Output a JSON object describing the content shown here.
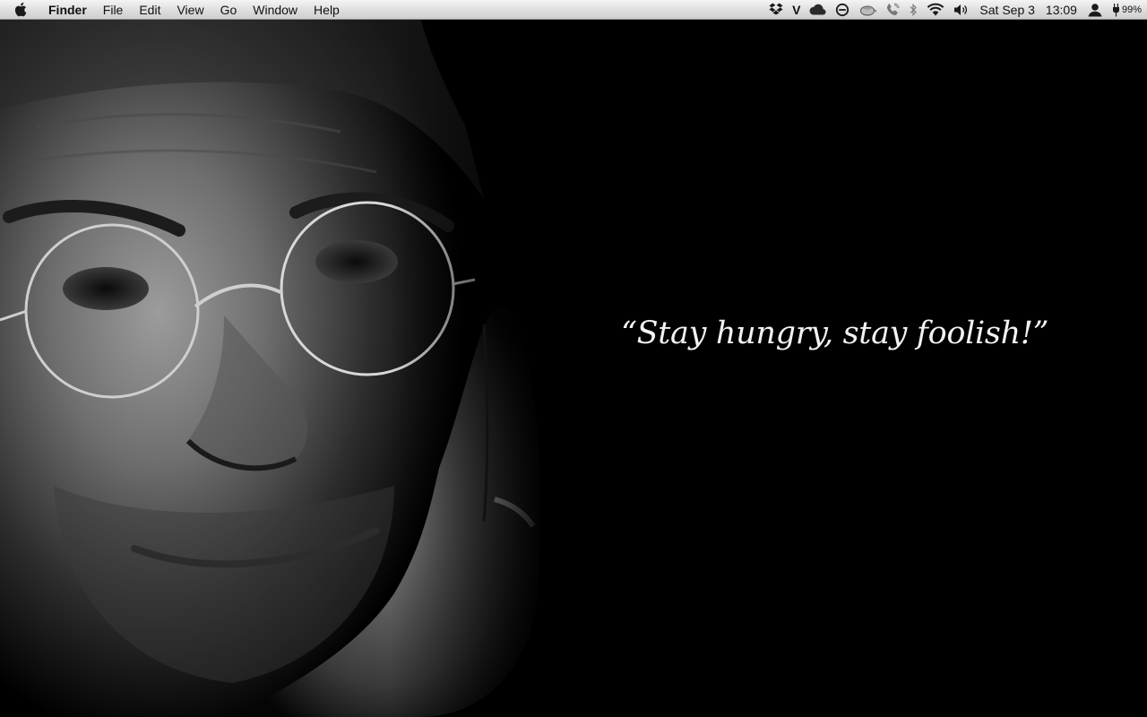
{
  "menubar": {
    "app_name": "Finder",
    "menus": [
      "File",
      "Edit",
      "View",
      "Go",
      "Window",
      "Help"
    ],
    "status_icons": [
      "dropbox-icon",
      "v-icon",
      "cloud-icon",
      "no-entry-icon",
      "teapot-icon",
      "phone-icon",
      "bluetooth-icon",
      "wifi-icon",
      "volume-icon"
    ],
    "v_label": "V",
    "date": "Sat Sep 3",
    "time": "13:09",
    "battery": "99%"
  },
  "wallpaper": {
    "quote": "“Stay hungry, stay foolish!”",
    "background_color": "#000000"
  }
}
